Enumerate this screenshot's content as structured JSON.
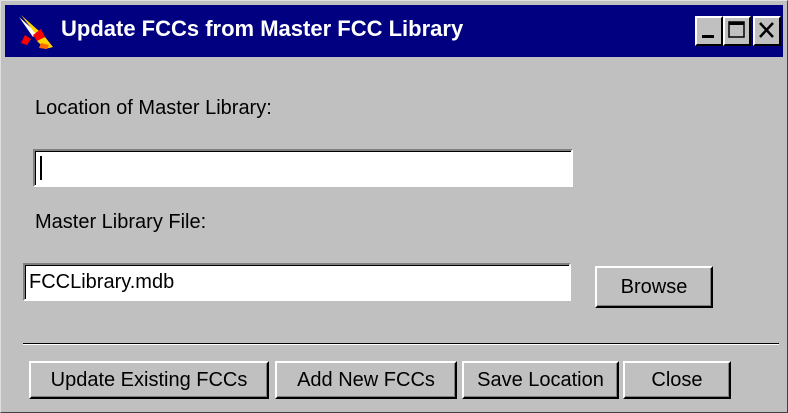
{
  "window": {
    "title": "Update FCCs from Master FCC Library",
    "icon": "paint-brush-icon",
    "controls": [
      "minimize-icon",
      "maximize-icon",
      "close-icon"
    ]
  },
  "form": {
    "location_label": "Location of Master Library:",
    "location_value": "",
    "file_label": "Master Library File:",
    "file_value": "FCCLibrary.mdb",
    "browse_label": "Browse"
  },
  "actions": {
    "update_label": "Update Existing FCCs",
    "add_label": "Add New FCCs",
    "save_label": "Save Location",
    "close_label": "Close"
  },
  "colors": {
    "titlebar": "#000080",
    "face": "#c0c0c0",
    "field": "#ffffff"
  }
}
